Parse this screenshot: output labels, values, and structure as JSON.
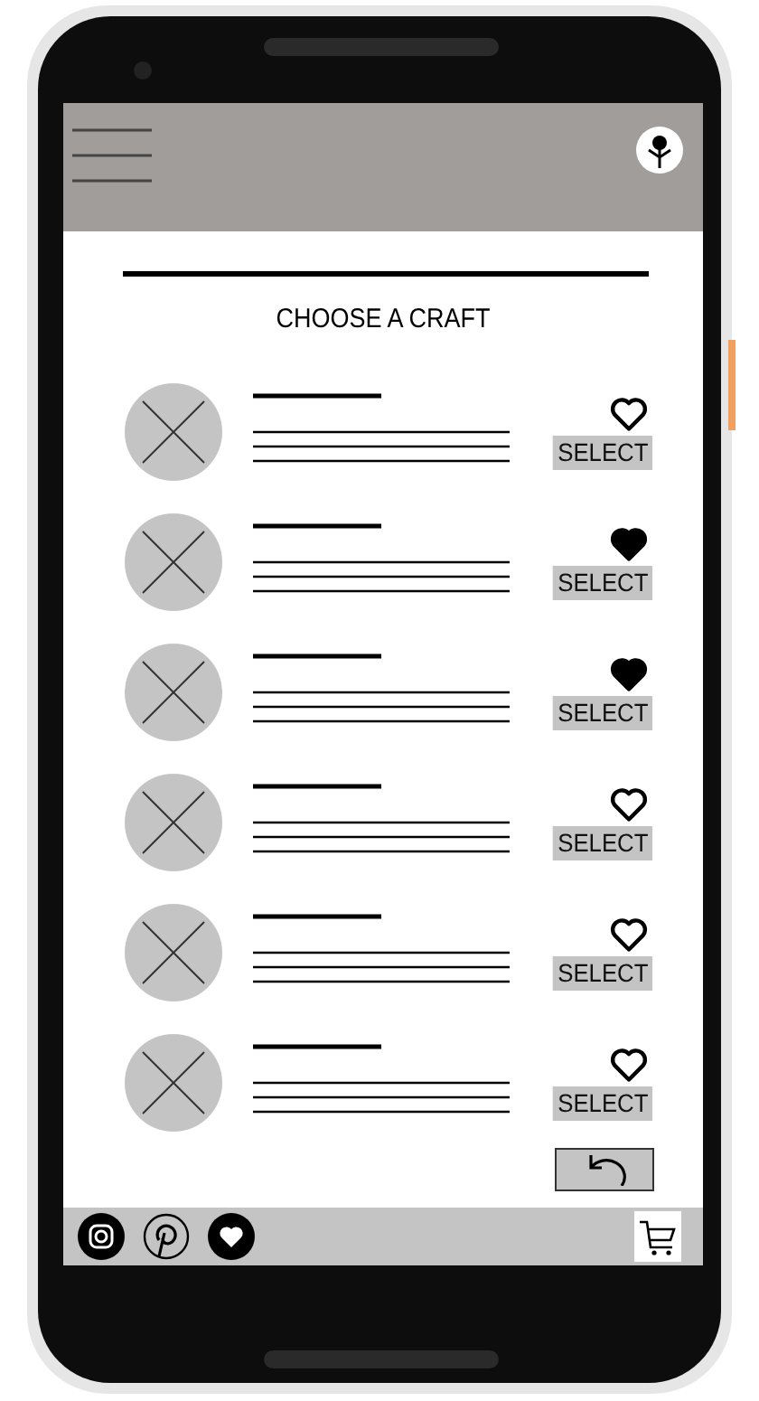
{
  "title": "CHOOSE A CRAFT",
  "crafts": [
    {
      "liked": false,
      "button": "SELECT"
    },
    {
      "liked": true,
      "button": "SELECT"
    },
    {
      "liked": true,
      "button": "SELECT"
    },
    {
      "liked": false,
      "button": "SELECT"
    },
    {
      "liked": false,
      "button": "SELECT"
    },
    {
      "liked": false,
      "button": "SELECT"
    }
  ]
}
